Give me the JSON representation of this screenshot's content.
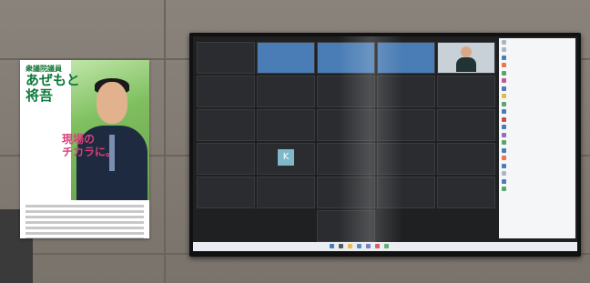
{
  "poster": {
    "top_label": "衆議院議員",
    "name_line1": "あぜもと",
    "name_line2": "将吾",
    "slogan_line1": "現場の",
    "slogan_line2": "チカラに。"
  },
  "meeting": {
    "highlight_name": "",
    "k_avatar": "K"
  },
  "colors": {
    "tile_bg": "#2b2c2f",
    "highlight": "#4a7db5",
    "poster_green": "#0e7a3c",
    "slogan_pink": "#d6407a"
  }
}
